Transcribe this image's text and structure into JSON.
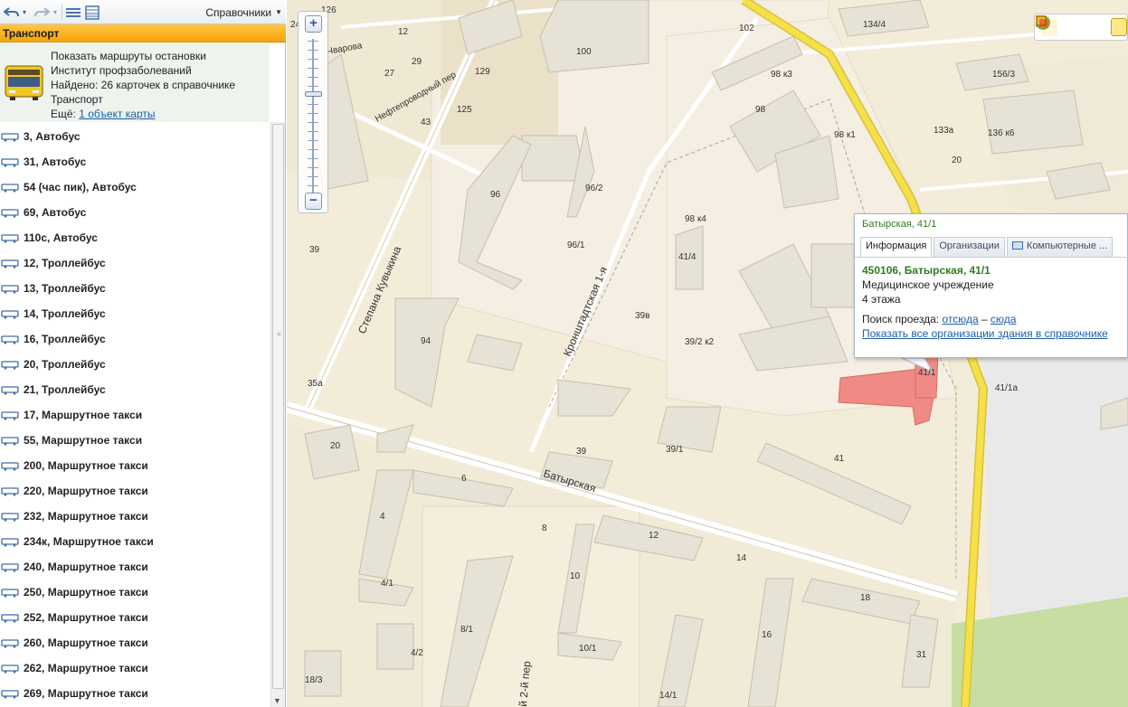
{
  "toolbar": {
    "directory_label": "Справочники",
    "icons": [
      "undo-icon",
      "redo-icon",
      "list-icon",
      "layout-icon"
    ]
  },
  "section": {
    "title": "Транспорт"
  },
  "info": {
    "line1": "Показать маршруты остановки",
    "line2": "Институт профзаболеваний",
    "line3": "Найдено: 26 карточек в справочнике",
    "line4": "Транспорт",
    "more_label": "Ещё:",
    "more_link": "1 объект карты"
  },
  "routes": [
    {
      "label": "3, Автобус"
    },
    {
      "label": "31, Автобус"
    },
    {
      "label": "54 (час пик), Автобус"
    },
    {
      "label": "69, Автобус"
    },
    {
      "label": "110с, Автобус"
    },
    {
      "label": "12, Троллейбус"
    },
    {
      "label": "13, Троллейбус"
    },
    {
      "label": "14, Троллейбус"
    },
    {
      "label": "16, Троллейбус"
    },
    {
      "label": "20, Троллейбус"
    },
    {
      "label": "21, Троллейбус"
    },
    {
      "label": "17, Маршрутное такси"
    },
    {
      "label": "55, Маршрутное такси"
    },
    {
      "label": "200, Маршрутное такси"
    },
    {
      "label": "220, Маршрутное такси"
    },
    {
      "label": "232, Маршрутное такси"
    },
    {
      "label": "234к, Маршрутное такси"
    },
    {
      "label": "240, Маршрутное такси"
    },
    {
      "label": "250, Маршрутное такси"
    },
    {
      "label": "252, Маршрутное такси"
    },
    {
      "label": "260, Маршрутное такси"
    },
    {
      "label": "262, Маршрутное такси"
    },
    {
      "label": "269, Маршрутное такси"
    }
  ],
  "map": {
    "streets": {
      "stepana_kuvykina": "Степана Кувыкина",
      "kronshtadtskaya": "Кронштадтская 1-я",
      "batyrskaya": "Батырская",
      "nefteprovodny": "Нефтепроводный пер",
      "cheverova": "Чварова",
      "per2": "й 2-й пер"
    },
    "house_numbers": [
      "24",
      "126",
      "12",
      "29",
      "27",
      "129",
      "125",
      "43",
      "100",
      "102",
      "134/4",
      "156/3",
      "98 к3",
      "98",
      "98 к1",
      "133а",
      "136 к6",
      "20",
      "96",
      "96/2",
      "96/1",
      "98 к4",
      "41/4",
      "39",
      "94",
      "39в",
      "39/2 к2",
      "35а",
      "41/1",
      "41/1а",
      "20",
      "6",
      "4",
      "8",
      "39",
      "39/1",
      "41",
      "12",
      "14",
      "10",
      "4/1",
      "8/1",
      "4/2",
      "10/1",
      "16",
      "18",
      "31",
      "18/3",
      "14/1"
    ]
  },
  "balloon": {
    "title": "Батырская, 41/1",
    "tabs": [
      "Информация",
      "Организации",
      "Компьютерные ..."
    ],
    "address": "450106, Батырская, 41/1",
    "type": "Медицинское учреждение",
    "floors": "4 этажа",
    "route_label": "Поиск проезда:",
    "from_here": "отсюда",
    "dash": "–",
    "to_here": "сюда",
    "show_all": "Показать все организации здания в справочнике"
  },
  "colors": {
    "header_orange": "#f8ae1a",
    "map_bg": "#f2ecd9",
    "highlight": "#f08a85",
    "road_yellow": "#f6e04a",
    "link": "#1a5ea8",
    "green_text": "#2f7d20"
  }
}
